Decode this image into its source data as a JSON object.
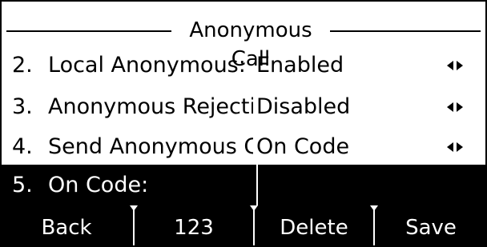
{
  "title": "Anonymous Call",
  "rows": [
    {
      "index": "2.",
      "label": "Local Anonymous:",
      "value": "Enabled",
      "icon": "left-right-arrows-icon"
    },
    {
      "index": "3.",
      "label": "Anonymous Rejectio",
      "value": "Disabled",
      "icon": "left-right-arrows-icon"
    },
    {
      "index": "4.",
      "label": "Send Anonymous Co",
      "value": "On Code",
      "icon": "left-right-arrows-icon"
    },
    {
      "index": "5.",
      "label": "On Code:",
      "value": ""
    }
  ],
  "softkeys": [
    "Back",
    "123",
    "Delete",
    "Save"
  ],
  "colors": {
    "background": "#ffffff",
    "highlight": "#000000",
    "highlight_text": "#ffffff"
  }
}
